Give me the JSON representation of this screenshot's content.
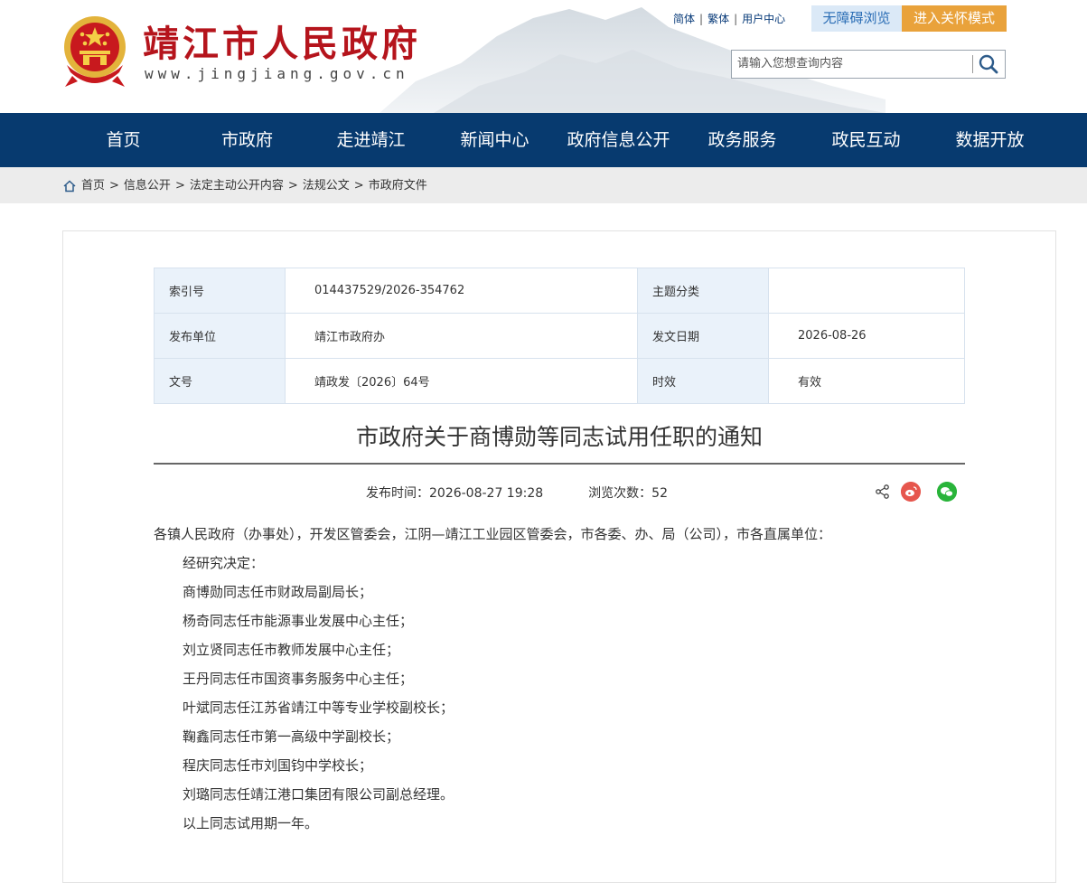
{
  "header": {
    "site_title": "靖江市人民政府",
    "site_url": "www.jingjiang.gov.cn",
    "links": [
      "简体",
      "繁体",
      "用户中心"
    ],
    "accessible_btn": "无障碍浏览",
    "care_btn": "进入关怀模式",
    "search_placeholder": "请输入您想查询内容"
  },
  "nav": [
    "首页",
    "市政府",
    "走进靖江",
    "新闻中心",
    "政府信息公开",
    "政务服务",
    "政民互动",
    "数据开放"
  ],
  "breadcrumb": [
    "首页",
    "信息公开",
    "法定主动公开内容",
    "法规公文",
    "市政府文件"
  ],
  "meta": {
    "index_label": "索引号",
    "index_value": "014437529/2026-354762",
    "topic_label": "主题分类",
    "topic_value": "",
    "unit_label": "发布单位",
    "unit_value": "靖江市政府办",
    "date_label": "发文日期",
    "date_value": "2026-08-26",
    "docno_label": "文号",
    "docno_value": "靖政发〔2026〕64号",
    "validity_label": "时效",
    "validity_value": "有效"
  },
  "document": {
    "title": "市政府关于商博勋等同志试用任职的通知",
    "publish_label": "发布时间：",
    "publish_time": "2026-08-27 19:28",
    "views_label": "浏览次数：",
    "views": "52",
    "salutation": "各镇人民政府（办事处），开发区管委会，江阴—靖江工业园区管委会，市各委、办、局（公司），市各直属单位：",
    "paragraphs": [
      "经研究决定：",
      "商博勋同志任市财政局副局长；",
      "杨奇同志任市能源事业发展中心主任；",
      "刘立贤同志任市教师发展中心主任；",
      "王丹同志任市国资事务服务中心主任；",
      "叶斌同志任江苏省靖江中等专业学校副校长；",
      "鞠鑫同志任市第一高级中学副校长；",
      "程庆同志任市刘国钧中学校长；",
      "刘璐同志任靖江港口集团有限公司副总经理。",
      "以上同志试用期一年。"
    ]
  },
  "colors": {
    "nav_bg": "#073a6f",
    "title_red": "#b5141c",
    "care_orange": "#e9a23b",
    "meta_key_bg": "#eaf2fa"
  }
}
